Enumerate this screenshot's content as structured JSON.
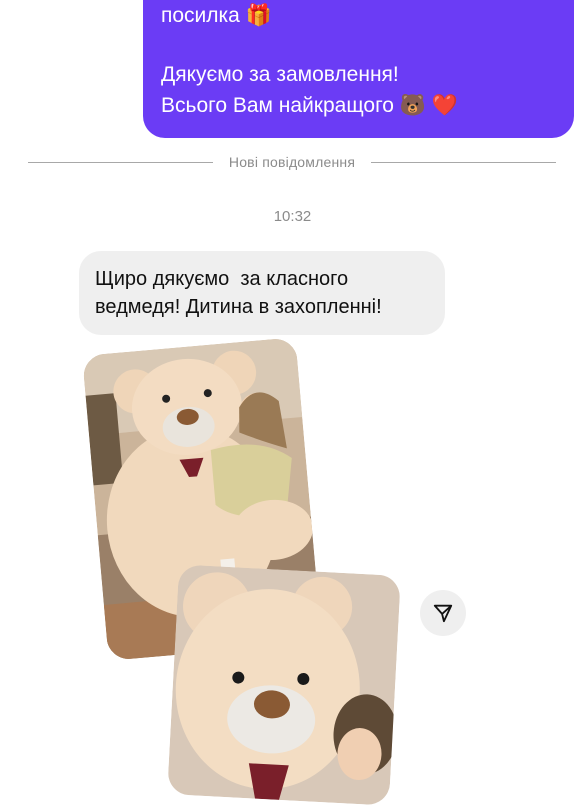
{
  "sent_message": {
    "line1": "посилка 🎁",
    "line2": "Дякуємо за замовлення!",
    "line3": "Всього Вам найкращого 🐻 ❤️"
  },
  "divider": {
    "label": "Нові повідомлення"
  },
  "timestamp": "10:32",
  "received_message": {
    "line1": "Щиро дякуємо  за класного",
    "line2": "ведмедя! Дитина в захопленні!"
  },
  "colors": {
    "sent_bubble": "#6b3cf5",
    "received_bubble": "#efefef",
    "muted_text": "#8b8b8b"
  },
  "icons": {
    "share": "send-icon"
  }
}
